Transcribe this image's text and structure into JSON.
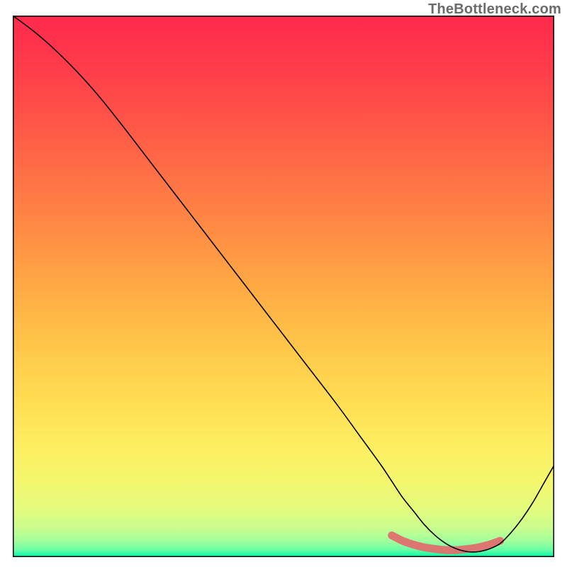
{
  "watermark": "TheBottleneck.com",
  "chart_data": {
    "type": "line",
    "title": "",
    "xlabel": "",
    "ylabel": "",
    "xlim": [
      0,
      100
    ],
    "ylim": [
      0,
      100
    ],
    "grid": false,
    "series": [
      {
        "name": "curve",
        "x": [
          0,
          4,
          8,
          12,
          16,
          20,
          25,
          30,
          35,
          40,
          45,
          50,
          55,
          60,
          64,
          68,
          70,
          72,
          74,
          76,
          78,
          80,
          82,
          84,
          86,
          88,
          90,
          92,
          94,
          96,
          98,
          100
        ],
        "y": [
          100,
          97,
          93.5,
          89.5,
          85,
          80,
          73.5,
          67,
          60.5,
          54,
          47.5,
          41,
          34.5,
          28,
          22.5,
          17,
          14,
          11,
          8.5,
          6,
          4,
          2.5,
          1.5,
          1,
          1,
          1.5,
          2.5,
          4.5,
          7,
          10,
          13.5,
          17
        ]
      },
      {
        "name": "highlight",
        "x": [
          70,
          72,
          74,
          76,
          78,
          80,
          82,
          84,
          86,
          88,
          90
        ],
        "y": [
          4.0,
          3.0,
          2.3,
          1.8,
          1.5,
          1.3,
          1.3,
          1.5,
          1.8,
          2.3,
          3.0
        ]
      }
    ],
    "background": {
      "type": "vertical-gradient",
      "stops": [
        {
          "offset": 0.0,
          "color": "#ff2a4d"
        },
        {
          "offset": 0.09,
          "color": "#ff3b4a"
        },
        {
          "offset": 0.18,
          "color": "#ff5148"
        },
        {
          "offset": 0.27,
          "color": "#ff6946"
        },
        {
          "offset": 0.36,
          "color": "#ff8245"
        },
        {
          "offset": 0.45,
          "color": "#ff9b44"
        },
        {
          "offset": 0.54,
          "color": "#ffb446"
        },
        {
          "offset": 0.63,
          "color": "#ffcb4b"
        },
        {
          "offset": 0.72,
          "color": "#ffdf54"
        },
        {
          "offset": 0.8,
          "color": "#fdef61"
        },
        {
          "offset": 0.86,
          "color": "#f4f76e"
        },
        {
          "offset": 0.91,
          "color": "#e4fb7d"
        },
        {
          "offset": 0.946,
          "color": "#c9fd8d"
        },
        {
          "offset": 0.97,
          "color": "#a3fe9b"
        },
        {
          "offset": 0.986,
          "color": "#6cfea6"
        },
        {
          "offset": 1.0,
          "color": "#00f7a8"
        }
      ]
    },
    "highlight_color": "#e06f6f"
  }
}
